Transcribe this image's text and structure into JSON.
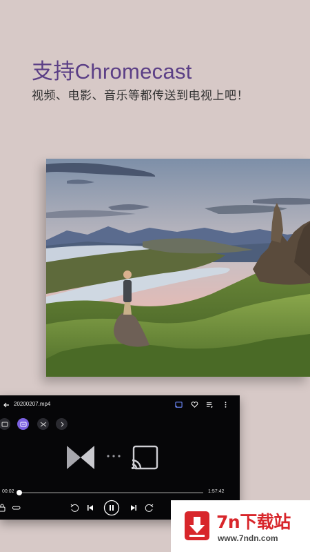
{
  "promo": {
    "title": "支持Chromecast",
    "subtitle": "视频、电影、音乐等都传送到电视上吧！"
  },
  "photo": {
    "subject": "landscape-photo"
  },
  "player": {
    "file_name": "20200207.mp4",
    "time_current": "00:02",
    "time_total": "1:57:42",
    "progress": 0.01,
    "accent_color": "#7b61e0",
    "top_icons": [
      "cast-icon",
      "heart-icon",
      "playlist-icon",
      "more-icon"
    ],
    "chips": [
      "screenshot-icon",
      "subtitle-icon",
      "shuffle-icon",
      "chevron-right-icon"
    ],
    "controls": [
      "lock-icon",
      "repeat-icon",
      "rewind-10-icon",
      "previous-icon",
      "pause-icon",
      "next-icon",
      "forward-10-icon"
    ]
  },
  "watermark": {
    "name": "7n下载站",
    "url": "www.7ndn.com",
    "brand_color": "#d8262b"
  }
}
